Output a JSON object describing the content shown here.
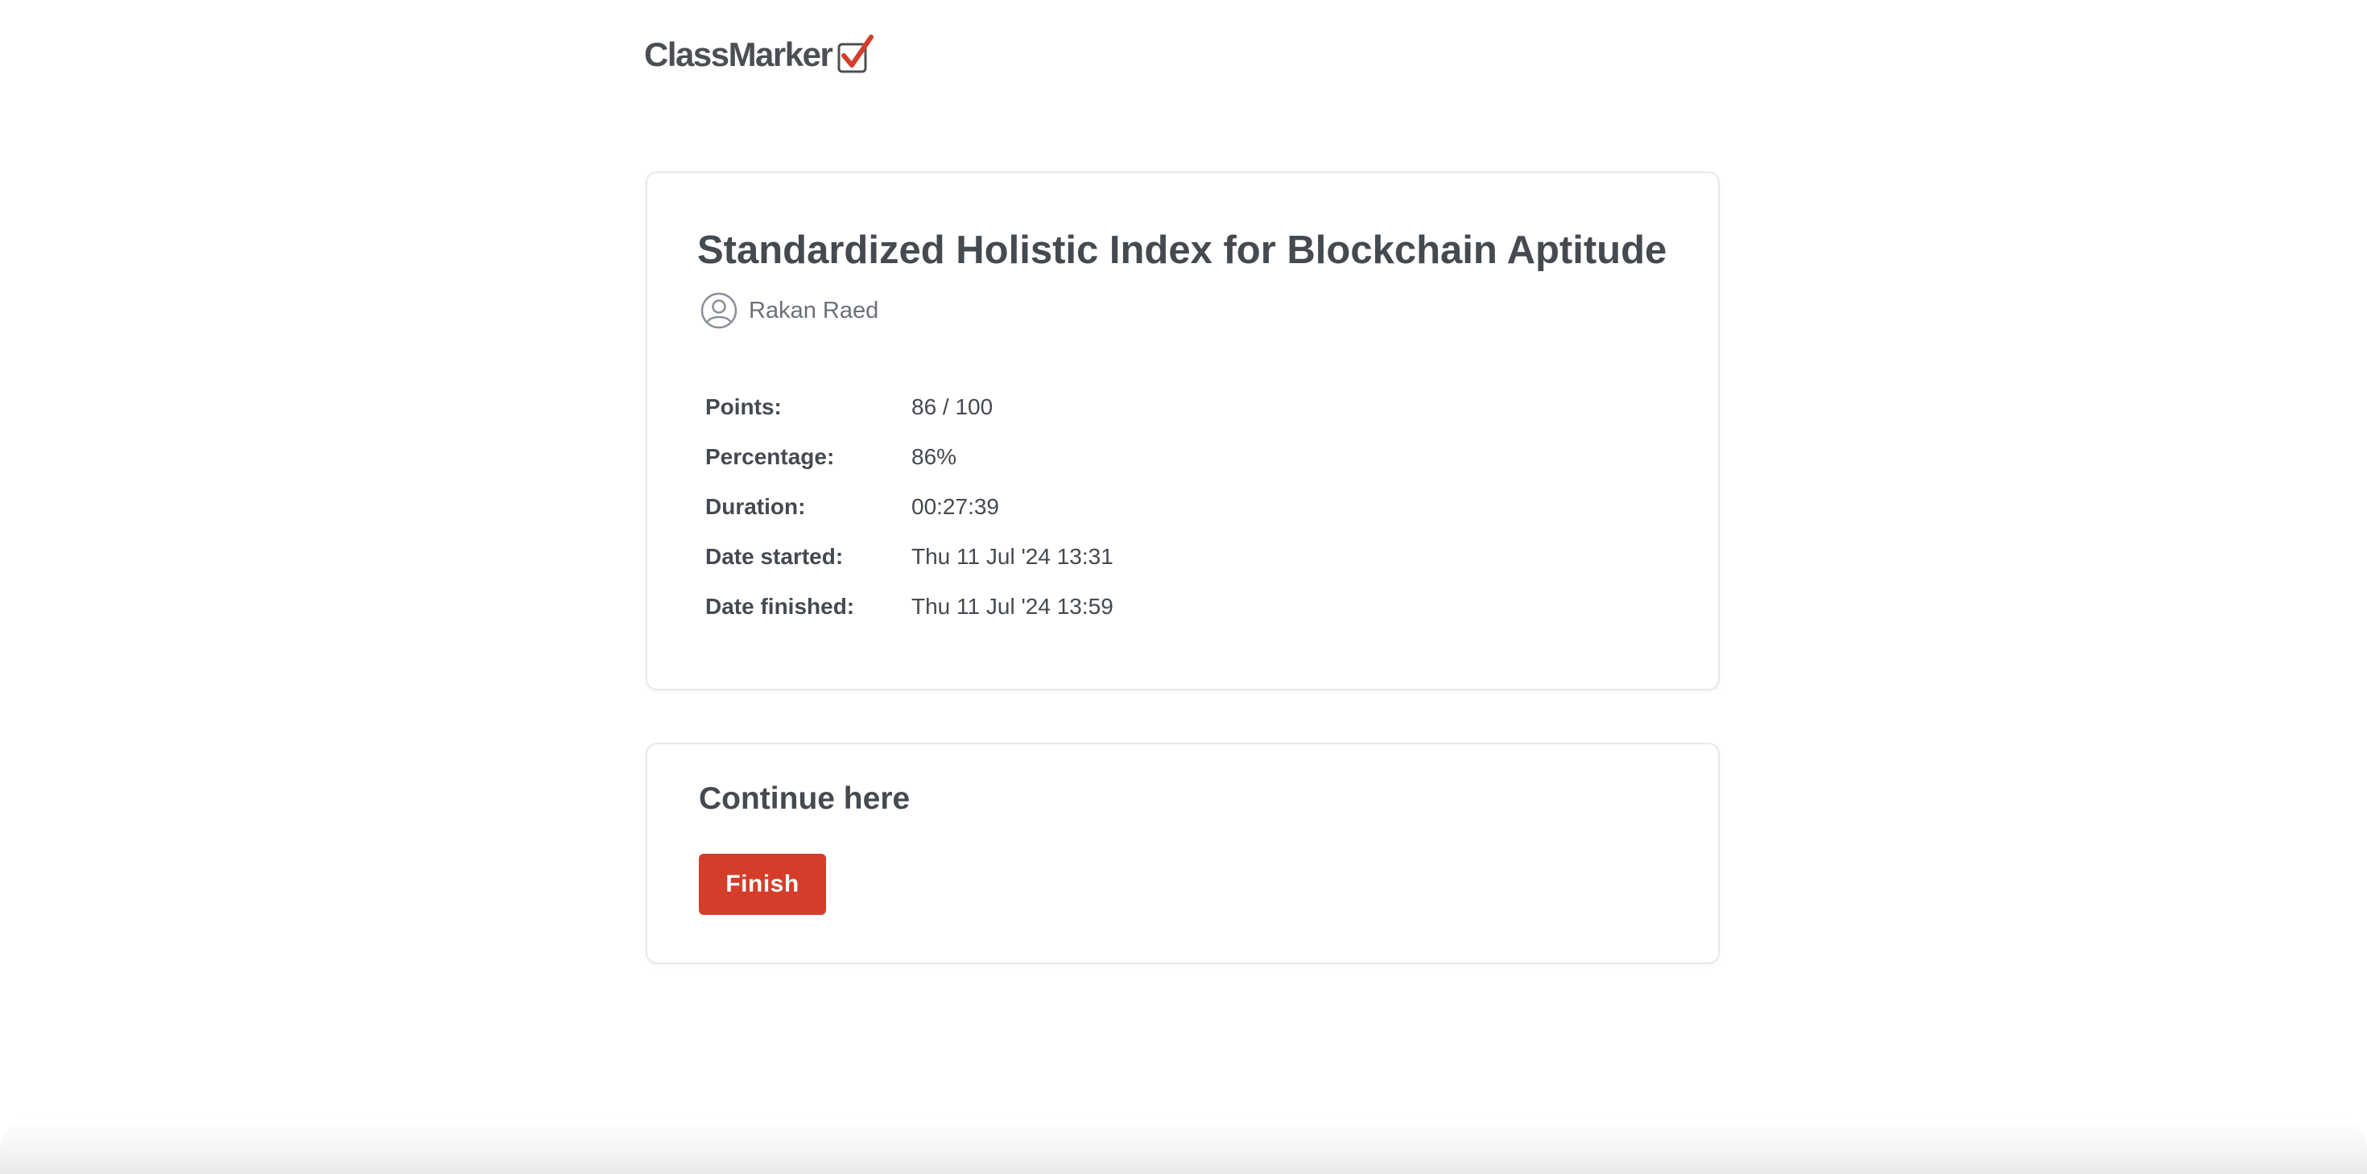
{
  "brand": {
    "name": "ClassMarker",
    "accent_color": "#d43d2a",
    "check_icon": "checkbox-check-icon"
  },
  "results": {
    "exam_title": "Standardized Holistic Index for Blockchain Aptitude",
    "user_icon": "user-avatar-icon",
    "user_name": "Rakan Raed",
    "stats": [
      {
        "label": "Points:",
        "value": "86 / 100"
      },
      {
        "label": "Percentage:",
        "value": "86%"
      },
      {
        "label": "Duration:",
        "value": "00:27:39"
      },
      {
        "label": "Date started:",
        "value": "Thu 11 Jul '24 13:31"
      },
      {
        "label": "Date finished:",
        "value": "Thu 11 Jul '24 13:59"
      }
    ]
  },
  "continue_section": {
    "heading": "Continue here",
    "finish_label": "Finish"
  }
}
